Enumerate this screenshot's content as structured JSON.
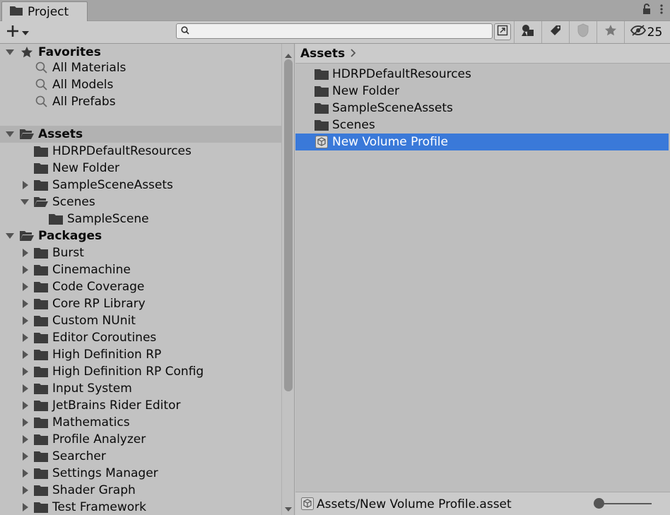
{
  "window": {
    "tab_title": "Project",
    "tab_icon": "folder-icon"
  },
  "toolbar": {
    "create_icon": "plus-icon",
    "search": {
      "placeholder": "",
      "value": ""
    },
    "hidden_count": "25"
  },
  "favorites": {
    "header": "Favorites",
    "items": [
      {
        "label": "All Materials"
      },
      {
        "label": "All Models"
      },
      {
        "label": "All Prefabs"
      }
    ]
  },
  "assets_tree": {
    "header": "Assets",
    "items": [
      {
        "label": "HDRPDefaultResources",
        "arrow": "none"
      },
      {
        "label": "New Folder",
        "arrow": "none"
      },
      {
        "label": "SampleSceneAssets",
        "arrow": "collapsed"
      },
      {
        "label": "Scenes",
        "arrow": "expanded"
      },
      {
        "label": "SampleScene",
        "arrow": "none",
        "child": true
      }
    ]
  },
  "packages_tree": {
    "header": "Packages",
    "items": [
      {
        "label": "Burst"
      },
      {
        "label": "Cinemachine"
      },
      {
        "label": "Code Coverage"
      },
      {
        "label": "Core RP Library"
      },
      {
        "label": "Custom NUnit"
      },
      {
        "label": "Editor Coroutines"
      },
      {
        "label": "High Definition RP"
      },
      {
        "label": "High Definition RP Config"
      },
      {
        "label": "Input System"
      },
      {
        "label": "JetBrains Rider Editor"
      },
      {
        "label": "Mathematics"
      },
      {
        "label": "Profile Analyzer"
      },
      {
        "label": "Searcher"
      },
      {
        "label": "Settings Manager"
      },
      {
        "label": "Shader Graph"
      },
      {
        "label": "Test Framework"
      }
    ]
  },
  "right_panel": {
    "breadcrumb": "Assets",
    "items": [
      {
        "label": "HDRPDefaultResources",
        "type": "folder"
      },
      {
        "label": "New Folder",
        "type": "folder"
      },
      {
        "label": "SampleSceneAssets",
        "type": "folder"
      },
      {
        "label": "Scenes",
        "type": "folder"
      },
      {
        "label": "New Volume Profile",
        "type": "asset",
        "selected": true
      }
    ],
    "status_path": "Assets/New Volume Profile.asset"
  },
  "colors": {
    "selection": "#3a79d9",
    "panel_bg": "#c2c2c2",
    "header_bg": "#b2b2b2"
  }
}
